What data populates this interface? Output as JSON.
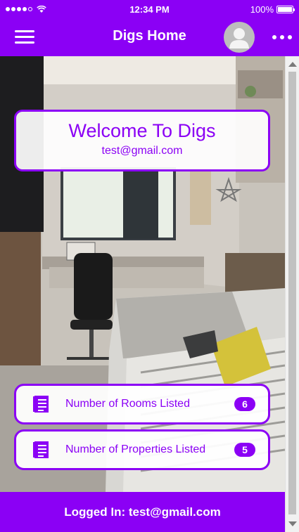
{
  "status_bar": {
    "time": "12:34 PM",
    "battery": "100%",
    "battery_level": 1.0,
    "signal_bars_filled": 4,
    "signal_bars_total": 5,
    "wifi_icon": "wifi-icon"
  },
  "header": {
    "title": "Digs Home",
    "menu_icon": "hamburger-menu-icon",
    "avatar_icon": "user-avatar-icon",
    "more_icon": "more-dots-icon"
  },
  "welcome": {
    "title": "Welcome To Digs",
    "email": "test@gmail.com"
  },
  "stats": [
    {
      "label": "Number of Rooms Listed",
      "count": "6",
      "icon": "document-list-icon"
    },
    {
      "label": "Number of Properties Listed",
      "count": "5",
      "icon": "document-list-icon"
    }
  ],
  "footer": {
    "text": "Logged In: test@gmail.com"
  },
  "colors": {
    "accent": "#8b00f5",
    "on_accent": "#ffffff"
  }
}
